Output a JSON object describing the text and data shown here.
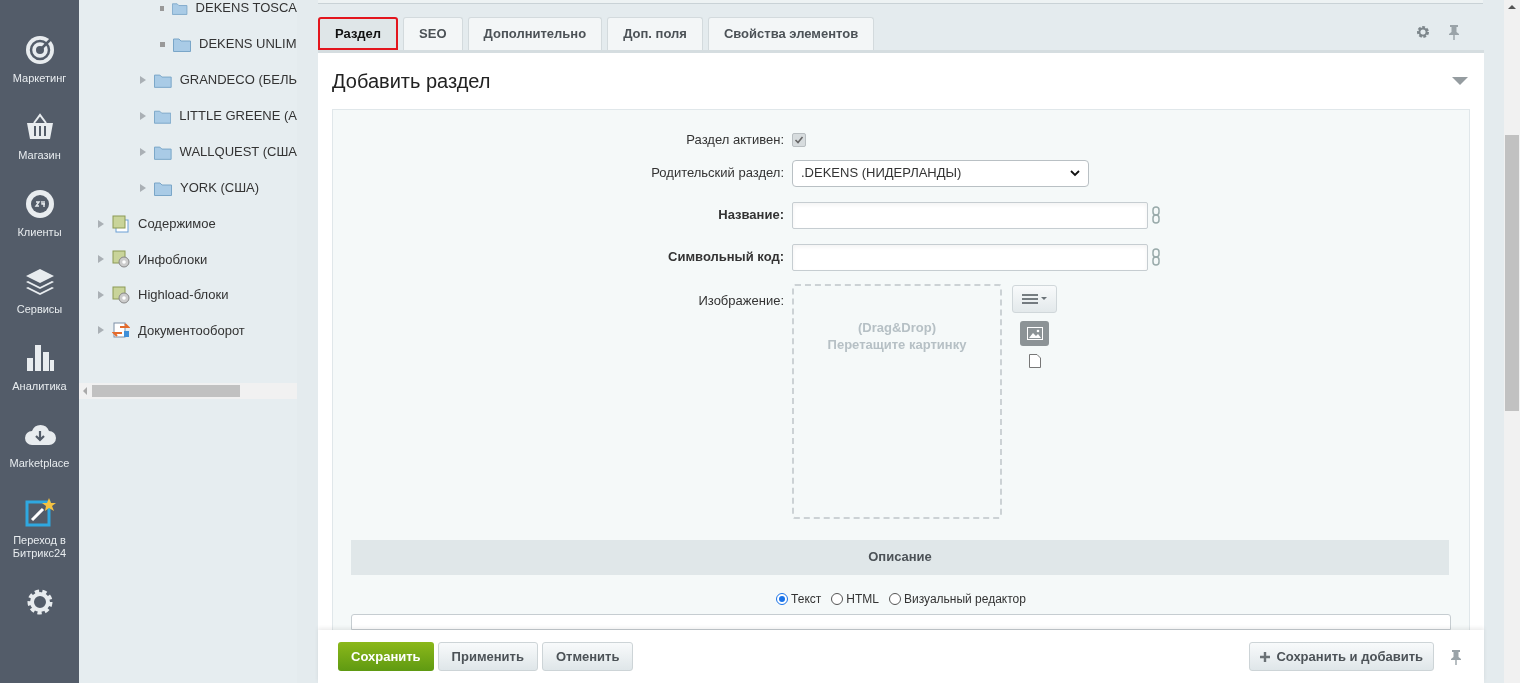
{
  "nav": [
    {
      "label": "Маркетинг",
      "kind": "target"
    },
    {
      "label": "Магазин",
      "kind": "basket"
    },
    {
      "label": "Клиенты",
      "kind": "crm"
    },
    {
      "label": "Сервисы",
      "kind": "layers"
    },
    {
      "label": "Аналитика",
      "kind": "chart"
    },
    {
      "label": "Marketplace",
      "kind": "cloud"
    },
    {
      "label": "Переход в Битрикс24",
      "kind": "wand"
    },
    {
      "kind": "gear"
    }
  ],
  "tree": {
    "nested": [
      {
        "label": "DEKENS TOSCA"
      },
      {
        "label": "DEKENS UNLIM"
      }
    ],
    "folders": [
      {
        "label": "GRANDECO (БЕЛЬ",
        "expanded": false
      },
      {
        "label": "LITTLE GREENE (А",
        "expanded": false
      },
      {
        "label": "WALLQUEST (США",
        "expanded": false
      },
      {
        "label": "YORK (США)",
        "expanded": false
      }
    ],
    "modules": [
      {
        "label": "Содержимое",
        "expanded": false,
        "kind": "content"
      },
      {
        "label": "Инфоблоки",
        "expanded": false,
        "kind": "iblock"
      },
      {
        "label": "Highload-блоки",
        "expanded": false,
        "kind": "iblock"
      },
      {
        "label": "Документооборот",
        "expanded": false,
        "kind": "docflow"
      }
    ]
  },
  "tabs": [
    {
      "label": "Раздел",
      "selected": true
    },
    {
      "label": "SEO",
      "selected": false
    },
    {
      "label": "Дополнительно",
      "selected": false
    },
    {
      "label": "Доп. поля",
      "selected": false
    },
    {
      "label": "Свойства элементов",
      "selected": false
    }
  ],
  "form": {
    "title": "Добавить раздел",
    "active": {
      "label": "Раздел активен:",
      "checked": true
    },
    "parent": {
      "label": "Родительский раздел:",
      "value": ".DEKENS (НИДЕРЛАНДЫ)"
    },
    "name": {
      "label": "Название:"
    },
    "code": {
      "label": "Символьный код:"
    },
    "image": {
      "label": "Изображение:",
      "hint_1": "(Drag&Drop)",
      "hint_2": "Перетащите картинку"
    },
    "description": {
      "heading": "Описание",
      "modes": [
        {
          "label": "Текст",
          "selected": true
        },
        {
          "label": "HTML",
          "selected": false
        },
        {
          "label": "Визуальный редактор",
          "selected": false
        }
      ]
    }
  },
  "footer": {
    "buttons": [
      {
        "label": "Сохранить",
        "kind": "primary"
      },
      {
        "label": "Применить",
        "kind": "plain"
      },
      {
        "label": "Отменить",
        "kind": "plain"
      }
    ],
    "save_add": "Сохранить и добавить"
  }
}
